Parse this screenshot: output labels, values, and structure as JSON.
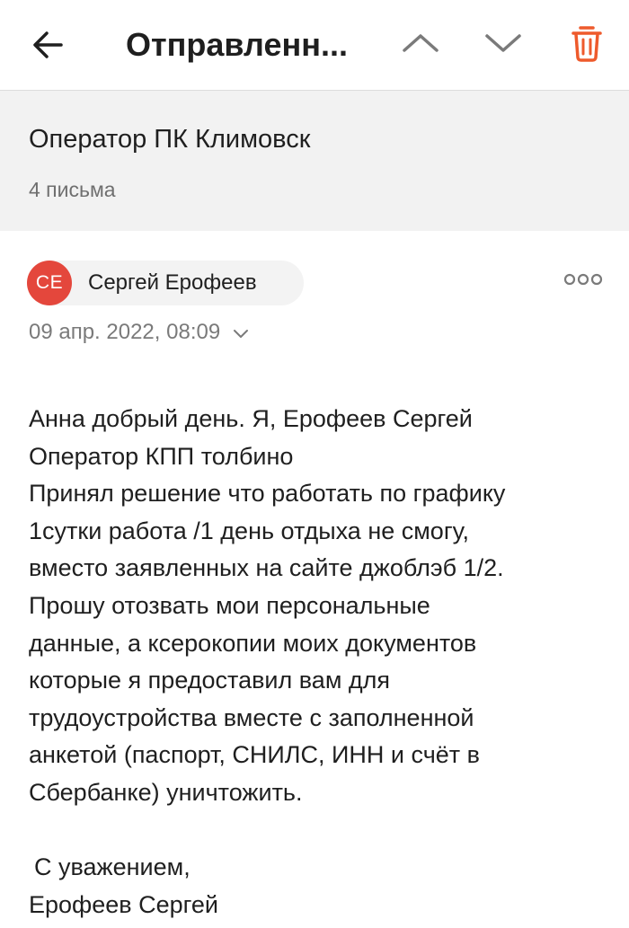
{
  "topbar": {
    "title": "Отправленн...",
    "icons": {
      "back": "arrow-left-icon",
      "prev": "chevron-up-icon",
      "next": "chevron-down-icon",
      "delete": "trash-icon"
    },
    "delete_color": "#ee5a2c"
  },
  "thread": {
    "title": "Оператор ПК Климовск",
    "count": "4 письма"
  },
  "message": {
    "avatar_initials": "CE",
    "avatar_color": "#e4473c",
    "sender": "Сергей Ерофеев",
    "date": "09 апр. 2022, 08:09",
    "body": [
      "Анна добрый день. Я, Ерофеев Сергей",
      "Оператор КПП толбино",
      "Принял решение что работать по графику",
      "1сутки работа /1 день отдыха не смогу,",
      "вместо заявленных на сайте джоблэб 1/2.",
      "Прошу отозвать мои персональные",
      "данные, а ксерокопии моих документов",
      "которые я предоставил вам для",
      "трудоустройства вместе с заполненной",
      "анкетой (паспорт, СНИЛС, ИНН и счёт в",
      "Сбербанке) уничтожить."
    ],
    "closing": "С уважением,",
    "signature": "Ерофеев Сергей"
  }
}
